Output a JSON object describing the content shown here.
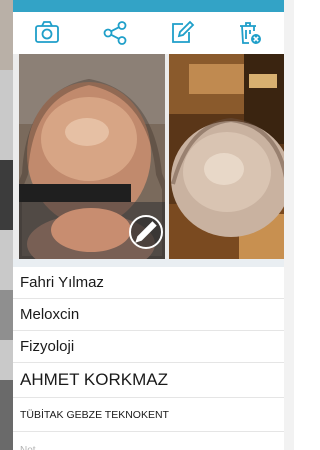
{
  "colors": {
    "accent": "#33a3c6",
    "icon": "#1f9fc9",
    "text": "#1a1a1a",
    "placeholder": "#b3b3b3"
  },
  "toolbar": {
    "icons": [
      "camera-icon",
      "share-icon",
      "edit-icon",
      "delete-icon"
    ]
  },
  "photos": [
    {
      "name": "photo-1",
      "edit_icon": "pencil-icon"
    },
    {
      "name": "photo-2"
    }
  ],
  "fields": {
    "name": "Fahri Yılmaz",
    "medication": "Meloxcin",
    "department": "Fizyoloji",
    "person": "AHMET KORKMAZ",
    "organization": "TÜBİTAK GEBZE TEKNOKENT",
    "note_placeholder": "Not"
  }
}
